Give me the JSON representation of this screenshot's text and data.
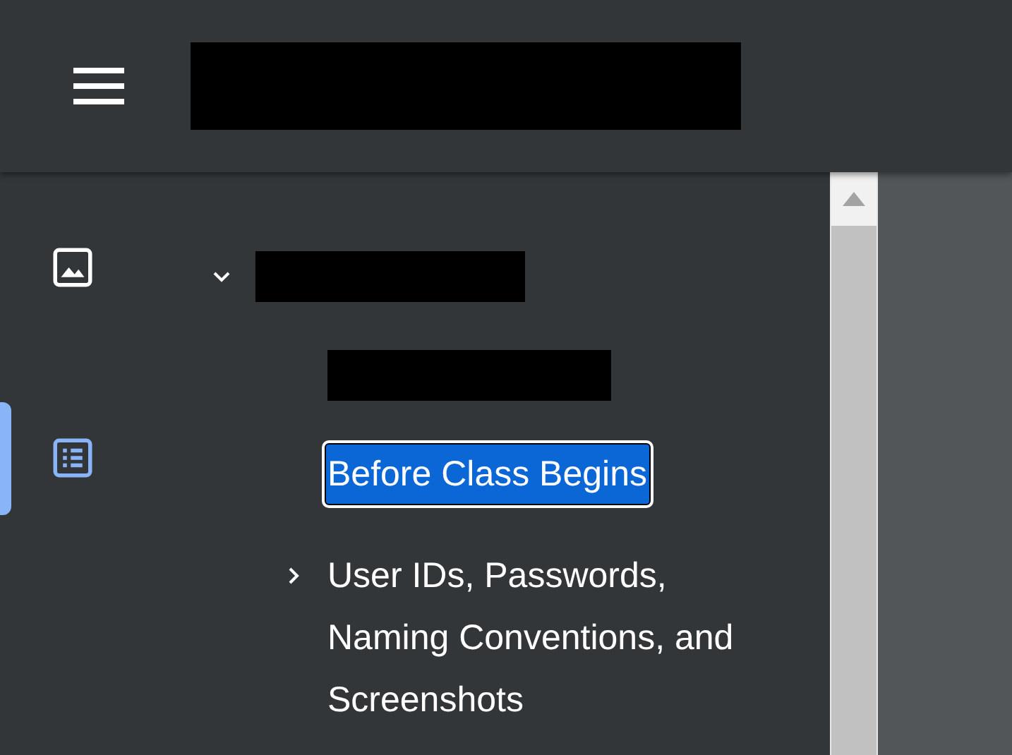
{
  "header": {
    "title": {
      "kind": "redacted"
    }
  },
  "sidebar_tabs": [
    {
      "kind": "thumbnails",
      "selected": false
    },
    {
      "kind": "outline",
      "selected": true
    }
  ],
  "outline": [
    {
      "kind": "redacted",
      "selected": false,
      "expanded": true,
      "children": [
        {
          "kind": "redacted",
          "selected": false
        },
        {
          "kind": "text",
          "title": "Before Class Begins",
          "selected": true
        },
        {
          "kind": "text",
          "title": "User IDs, Passwords, Naming Conventions, and Screenshots",
          "selected": false,
          "expanded": false
        }
      ]
    }
  ]
}
